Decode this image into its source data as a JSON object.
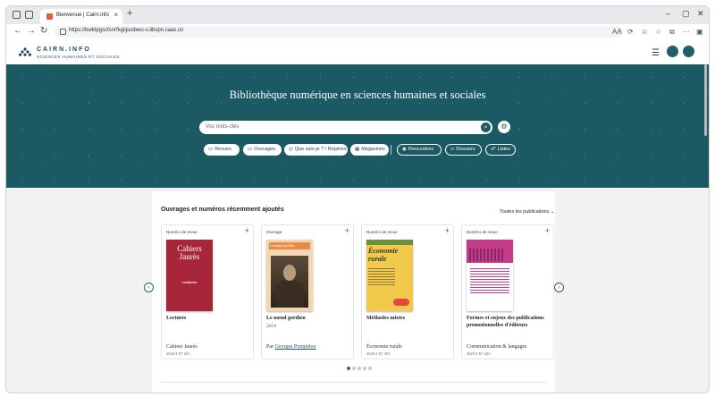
{
  "browser": {
    "tab_title": "Bienvenue | Cairn.info",
    "tab_close": "×",
    "new_tab": "+",
    "url": "https://bwktpgscfsnrfkgiijsoibwu-s.libvpn.caas.cn",
    "nav_back": "←",
    "nav_forward": "→",
    "nav_reload": "↻",
    "win_min": "–",
    "win_max": "▢",
    "win_close": "✕",
    "toolbar_icons": [
      "aa-icon",
      "extension-icon",
      "emoji-icon",
      "star-icon",
      "collections-icon",
      "more-icon",
      "sidebar-icon"
    ],
    "toolbar_glyphs": [
      "A͏A",
      "⟳",
      "☺",
      "☆",
      "⧉",
      "···",
      "▣"
    ]
  },
  "site": {
    "logo_text": "CAIRN.INFO",
    "logo_sub": "SCIENCES HUMAINES ET SOCIALES",
    "menu_glyph": "☰"
  },
  "hero": {
    "title": "Bibliothèque numérique en sciences humaines et sociales",
    "search_placeholder": "Vos mots-clés",
    "search_glyph": "⌕",
    "advanced_glyph": "⚙",
    "filters": [
      {
        "label": "Revues",
        "icon": "▭"
      },
      {
        "label": "Ouvrages",
        "icon": "▭"
      },
      {
        "label": "Que sais-je ? / Repères",
        "icon": "◎"
      },
      {
        "label": "Magazines",
        "icon": "▦"
      }
    ],
    "links": [
      {
        "label": "Rencontres",
        "icon": "◉"
      },
      {
        "label": "Dossiers",
        "icon": "▱"
      },
      {
        "label": "Listes",
        "icon": "☍"
      }
    ]
  },
  "recent": {
    "title": "Ouvrages et numéros récemment ajoutés",
    "all_link": "Toutes les publications",
    "all_chevron": "⌄",
    "prev": "‹",
    "next": "›",
    "cards": [
      {
        "type": "Numéro de revue",
        "title": "Lectures",
        "subtitle": "",
        "author_prefix": "",
        "author": "",
        "source": "Cahiers Jaurès",
        "issue": "2024/1 N° 251",
        "cover_title": "Cahiers Jaurès",
        "cover_sub": "Lectures"
      },
      {
        "type": "Ouvrage",
        "title": "Le nœud gordien",
        "subtitle": "2024",
        "author_prefix": "Par",
        "author": "Georges Pompidou",
        "source": "",
        "issue": "",
        "cover_title": "Le nœud gordien",
        "cover_sub": ""
      },
      {
        "type": "Numéro de revue",
        "title": "Méthodes mixtes",
        "subtitle": "",
        "author_prefix": "",
        "author": "",
        "source": "Économie rurale",
        "issue": "2025/1 N° 391",
        "cover_title": "Économie rurale",
        "cover_sub": ""
      },
      {
        "type": "Numéro de revue",
        "title": "Formes et enjeux des publications promotionnelles d'éditeurs",
        "subtitle": "",
        "author_prefix": "",
        "author": "",
        "source": "Communication & langages",
        "issue": "2025/1 N° 223",
        "cover_title": "",
        "cover_sub": ""
      }
    ],
    "carousel_pages": 5,
    "carousel_active": 1
  }
}
